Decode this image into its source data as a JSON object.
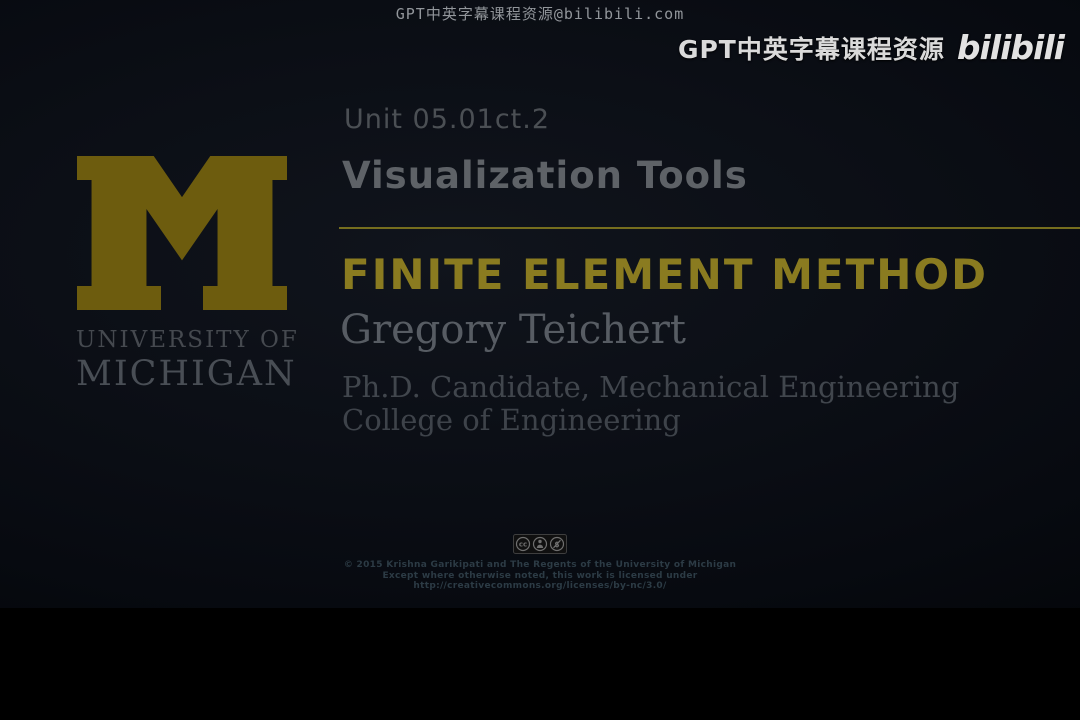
{
  "watermarks": {
    "top_center": "GPT中英字幕课程资源@bilibili.com",
    "top_right_text": "GPT中英字幕课程资源",
    "bilibili_logo_text": "bilibili"
  },
  "slide": {
    "unit_label": "Unit 05.01ct.2",
    "lecture_title": "Visualization Tools",
    "course_title": "FINITE ELEMENT METHOD",
    "presenter_name": "Gregory Teichert",
    "presenter_role": "Ph.D. Candidate, Mechanical Engineering",
    "presenter_affiliation": "College of Engineering",
    "university_logo": {
      "line1": "UNIVERSITY OF",
      "line2": "MICHIGAN"
    },
    "license": {
      "badge_icons": [
        "cc-icon",
        "attribution-person-icon",
        "noncommercial-no-dollar-icon"
      ],
      "line1": "© 2015 Krishna Garikipati and The Regents of the University of Michigan",
      "line2": "Except where otherwise noted, this work is licensed under",
      "line3": "http://creativecommons.org/licenses/by-nc/3.0/"
    }
  },
  "colors": {
    "maize_logo": "#6d5c0e",
    "course_title_gold": "#8a7b20",
    "divider_gold": "#766e1e",
    "lecture_title_gray": "#5e6267",
    "serif_text_gray": "#575c63",
    "license_text": "#2c3b45",
    "watermark_white": "#dadada",
    "background_dark": "#0b0e15",
    "letterbox": "#000000"
  }
}
